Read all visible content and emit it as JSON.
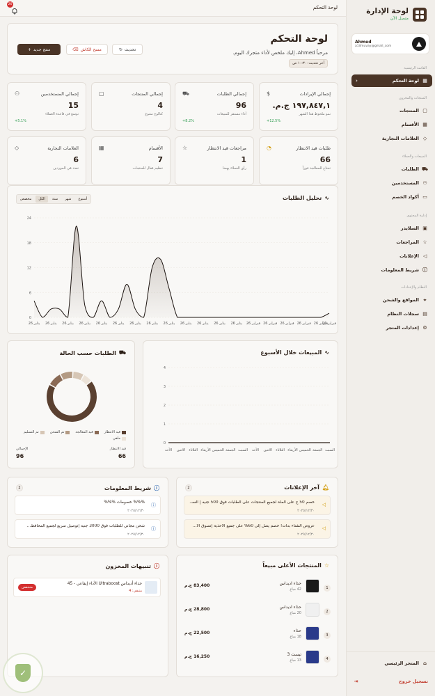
{
  "sidebar": {
    "title": "لوحة الإدارة",
    "online": "متصل الآن",
    "user": {
      "name": "Ahmed",
      "email": "a1ilmuvay@gmail_com"
    },
    "main_section": "القائمة الرئيسية",
    "active_item": "لوحة التحكم",
    "sections": [
      {
        "title": "المنتجات والمخزون",
        "items": [
          "المنتجات",
          "الأقسام",
          "العلامات التجارية"
        ]
      },
      {
        "title": "المبيعات والعملاء",
        "items": [
          "الطلبات",
          "المستخدمين",
          "أكواد الخصم"
        ]
      },
      {
        "title": "إدارة المحتوى",
        "items": [
          "السلايدر",
          "المراجعات",
          "الإعلانات",
          "شريط المعلومات"
        ]
      },
      {
        "title": "النظام والإعدادات",
        "items": [
          "المواقع والشحن",
          "سجلات النظام",
          "إعدادات المتجر"
        ]
      }
    ],
    "footer": {
      "store": "المتجر الرئيسي",
      "logout": "تسجيل خروج"
    }
  },
  "topbar": {
    "title": "لوحة التحكم",
    "notifications": "26"
  },
  "header": {
    "title": "لوحة التحكم",
    "subtitle": "مرحباً Ahmed، إليك ملخص لأداء متجرك اليوم.",
    "updated": "آخر تحديث: ١٠:٣٠ ص",
    "refresh": "تحديث",
    "clear_cache": "مسح الكاش",
    "new_product": "منتج جديد"
  },
  "stats": [
    {
      "label": "إجمالي الإيرادات",
      "value": "١٩٧,٨٤٧,١ ج.م.",
      "note": "نمو ملحوظ هذا الشهر",
      "trend": "12.5%+",
      "icon": "dollar-icon"
    },
    {
      "label": "إجمالي الطلبات",
      "value": "96",
      "note": "أداء مستقر للمبيعات",
      "trend": "8.2%+",
      "icon": "cart-icon"
    },
    {
      "label": "إجمالي المنتجات",
      "value": "4",
      "note": "كتالوج متنوع",
      "trend": "",
      "icon": "box-icon"
    },
    {
      "label": "إجمالي المستخدمين",
      "value": "15",
      "note": "توسع في قاعدة العملاء",
      "trend": "5.1%+",
      "icon": "users-icon"
    },
    {
      "label": "طلبات قيد الانتظار",
      "value": "66",
      "note": "تحتاج للمعالجة فوراً",
      "trend": "",
      "icon": "clock-icon"
    },
    {
      "label": "مراجعات قيد الانتظار",
      "value": "1",
      "note": "رأي العملاء يهمنا",
      "trend": "",
      "icon": "star-icon"
    },
    {
      "label": "الأقسام",
      "value": "7",
      "note": "تنظيم فعال للمنتجات",
      "trend": "",
      "icon": "grid-icon"
    },
    {
      "label": "العلامات التجارية",
      "value": "6",
      "note": "تعدد في الموردين",
      "trend": "",
      "icon": "tag-icon"
    }
  ],
  "orders_chart": {
    "title": "تحليل الطلبات",
    "tabs": [
      "أسبوع",
      "شهر",
      "سنة",
      "الكل",
      "مخصص"
    ],
    "selected_tab": "الكل"
  },
  "weekly_chart": {
    "title": "المبيعات خلال الأسبوع"
  },
  "status_chart": {
    "title": "الطلبات حسب الحالة",
    "legend": [
      "قيد الانتظار",
      "قيد المعالجة",
      "تم الشحن",
      "تم التسليم",
      "ملغي"
    ],
    "footer": [
      {
        "label": "الإجمالي",
        "value": "96"
      },
      {
        "label": "قيد الانتظار",
        "value": "66"
      }
    ]
  },
  "chart_data": [
    {
      "type": "area",
      "title": "تحليل الطلبات",
      "x": [
        "يناير 26",
        "يناير 26",
        "يناير 26",
        "يناير 26",
        "يناير 26",
        "يناير 26",
        "يناير 26",
        "يناير 26",
        "يناير 26",
        "يناير 26",
        "يناير 26",
        "يناير 26",
        "يناير 26",
        "يناير 26",
        "يناير 26",
        "يناير 26",
        "يناير 26",
        "يناير 26",
        "يناير 26",
        "يناير 26",
        "يناير 26",
        "يناير 26",
        "يناير 26",
        "يناير 26",
        "يناير 26",
        "فبراير 26",
        "فبراير 26",
        "فبراير 26",
        "فبراير 26",
        "فبراير 26",
        "فبراير 26",
        "فبراير 26",
        "فبراير 26",
        "فبراير 26",
        "فبراير 26",
        "فبراير 26"
      ],
      "values": [
        4,
        0,
        2,
        2,
        0,
        22,
        3,
        0,
        4,
        0,
        2,
        8,
        2,
        0,
        12,
        14,
        7,
        0,
        0,
        0,
        0,
        0,
        0,
        0,
        0,
        0,
        0,
        0,
        0,
        0,
        0,
        0,
        0,
        0,
        0,
        1
      ],
      "yticks": [
        0,
        6,
        12,
        18,
        24
      ],
      "ylim": [
        0,
        24
      ],
      "grid": true
    },
    {
      "type": "line",
      "title": "المبيعات خلال الأسبوع",
      "categories": [
        "الأحد",
        "الاثنين",
        "الثلاثاء",
        "الأربعاء",
        "الخميس",
        "الجمعة",
        "السبت",
        "الأحد",
        "الاثنين",
        "الثلاثاء",
        "الأربعاء",
        "الخميس",
        "الجمعة",
        "السبت"
      ],
      "values": [
        0,
        0,
        0,
        0,
        0,
        0,
        0,
        0,
        0,
        0,
        0,
        0,
        0,
        0
      ],
      "yticks": [
        0,
        1,
        2,
        3,
        4
      ],
      "ylim": [
        0,
        4
      ],
      "grid": true
    },
    {
      "type": "pie",
      "title": "الطلبات حسب الحالة",
      "labels": [
        "قيد الانتظار",
        "قيد المعالجة",
        "تم الشحن",
        "تم التسليم",
        "ملغي"
      ],
      "values": [
        66,
        9,
        8,
        7,
        6
      ],
      "colors": [
        "#5a4030",
        "#8a6a55",
        "#b39a83",
        "#d6c6b5",
        "#ece3d8"
      ]
    }
  ],
  "info_bar": {
    "title": "شريط المعلومات",
    "count": "2",
    "items": [
      {
        "text": "%%% خصومات %%%",
        "date": "٢٠٢٥/١٢/٣٠"
      },
      {
        "text": "شحن مجاني للطلبات فوق 3000 جنيه |توصيل سريع لجميع المحافظ...",
        "date": "٢٠٢٥/١٢/٣٠"
      }
    ]
  },
  "ads": {
    "title": "آخر الإعلانات",
    "count": "2",
    "items": [
      {
        "text": "خصم 50 ج على الملة لجميع المنتجات على الطلبات فوق 500 جنيه | السـ...",
        "date": "٢٠٢٥/١٢/٣٠"
      },
      {
        "text": "عروض الشتاء بدأت! خصم يصل إلى 60% على جميع الأحذية |تسوق الآ...",
        "date": "٢٠٢٥/١٢/٣٠"
      }
    ]
  },
  "stock_alerts": {
    "title": "تنبيهات المخزون",
    "items": [
      {
        "name": "حذاء أديداس Ultraboost الأداء إيقاعي - 45",
        "stock": "متبقي: 4",
        "status": "منخفض"
      }
    ]
  },
  "top_products": {
    "title": "المنتجات الأعلى مبيعاً",
    "items": [
      {
        "rank": "1",
        "name": "حذاء اديداس",
        "sold": "42 مباع",
        "price": "83,400 ج.م"
      },
      {
        "rank": "2",
        "name": "حذاء اديداس",
        "sold": "20 مباع",
        "price": "28,800 ج.م"
      },
      {
        "rank": "3",
        "name": "حذاء",
        "sold": "18 مباع",
        "price": "22,500 ج.م"
      },
      {
        "rank": "4",
        "name": "تيست 3",
        "sold": "13 مباع",
        "price": "16,250 ج.م"
      }
    ]
  },
  "colors": {
    "accent": "#4a3426",
    "background": "#f4f2ef",
    "success": "#2e9b4f",
    "danger": "#d32f2f"
  }
}
